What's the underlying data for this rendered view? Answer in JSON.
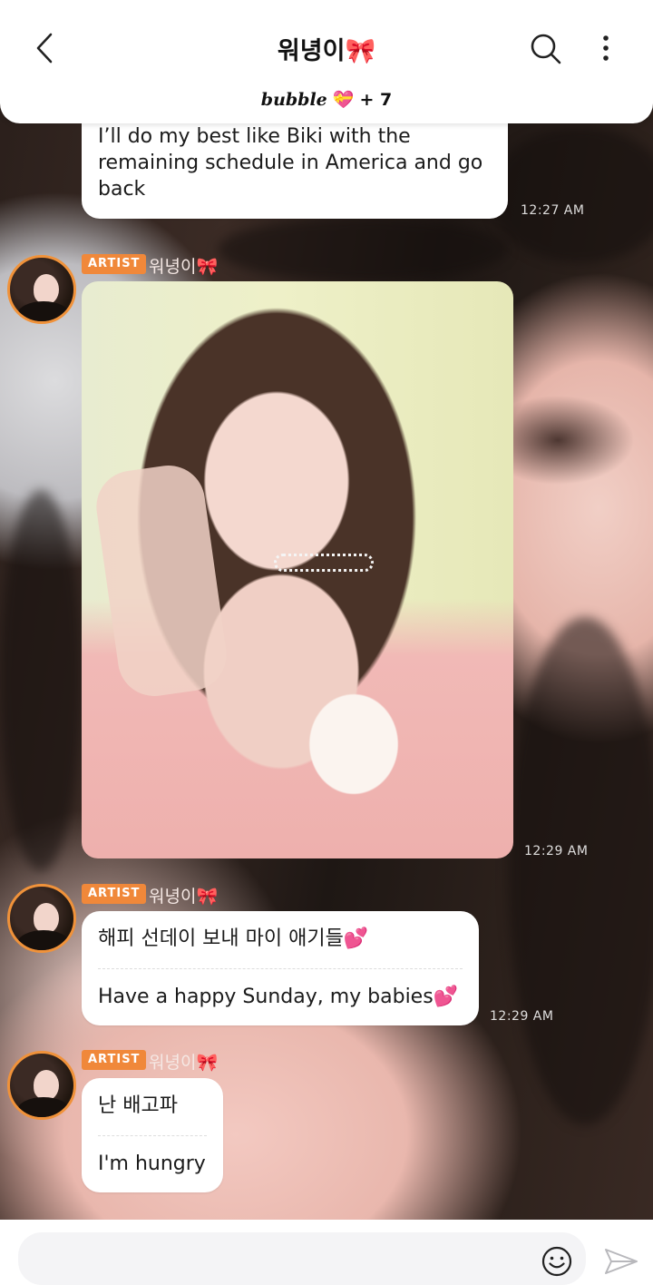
{
  "header": {
    "title": "워녕이",
    "title_emoji": "🎀",
    "subscriber_brand": "bubble",
    "subscriber_heart": "💝",
    "subscriber_count": "+ 7"
  },
  "messages": [
    {
      "type": "text",
      "lines": [
        "I’ll do my best like Biki with the",
        "remaining schedule in America and go",
        "back"
      ],
      "time": "12:27 AM"
    },
    {
      "type": "image",
      "sender_tag": "ARTIST",
      "sender_name": "워녕이",
      "sender_emoji": "🎀",
      "time": "12:29 AM"
    },
    {
      "type": "text",
      "sender_tag": "ARTIST",
      "sender_name": "워녕이",
      "sender_emoji": "🎀",
      "korean": "해피 선데이 보내 마이 애기들💕",
      "english": "Have a happy Sunday, my babies💕",
      "time": "12:29 AM"
    },
    {
      "type": "text",
      "sender_tag": "ARTIST",
      "sender_name": "워녕이",
      "sender_emoji": "🎀",
      "korean": "난 배고파",
      "english": "I'm hungry"
    }
  ],
  "icons": {
    "back": "chevron-left-icon",
    "search": "search-icon",
    "more": "more-vertical-icon",
    "emoji": "smiley-icon",
    "send": "send-icon"
  },
  "colors": {
    "artist_tag": "#f0883a",
    "avatar_ring": "#f0923a",
    "bubble": "#ffffff"
  }
}
